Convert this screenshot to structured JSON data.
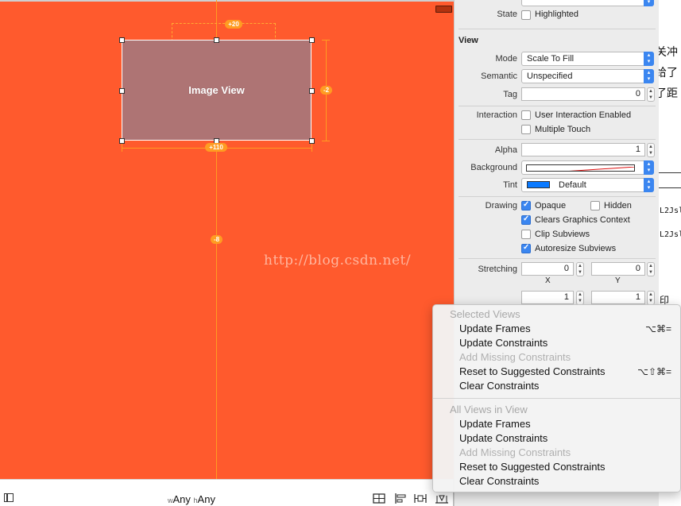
{
  "canvas": {
    "image_view_label": "Image View",
    "badges": {
      "top": "+20",
      "right": "-2",
      "bottom": "+110",
      "center": "-8"
    },
    "watermark": "http://blog.csdn.net/"
  },
  "bottom_bar": {
    "width_class_prefix": "w",
    "width_class_value": "Any",
    "height_class_prefix": "h",
    "height_class_value": "Any"
  },
  "inspector": {
    "state_label": "State",
    "highlighted_label": "Highlighted",
    "view_section": "View",
    "mode_label": "Mode",
    "mode_value": "Scale To Fill",
    "semantic_label": "Semantic",
    "semantic_value": "Unspecified",
    "tag_label": "Tag",
    "tag_value": "0",
    "interaction_label": "Interaction",
    "user_interaction": "User Interaction Enabled",
    "multiple_touch": "Multiple Touch",
    "alpha_label": "Alpha",
    "alpha_value": "1",
    "background_label": "Background",
    "tint_label": "Tint",
    "tint_value": "Default",
    "tint_color": "#0a7aff",
    "drawing_label": "Drawing",
    "opaque": "Opaque",
    "hidden": "Hidden",
    "clears_graphics": "Clears Graphics Context",
    "clip_subviews": "Clip Subviews",
    "autoresize_subviews": "Autoresize Subviews",
    "stretching_label": "Stretching",
    "stretch_x": "0",
    "stretch_y": "0",
    "x_caption": "X",
    "y_caption": "Y",
    "stretch_w": "1",
    "stretch_h": "1"
  },
  "right_strip": {
    "t1": "关冲",
    "t2": "给了",
    "t3": "了距",
    "t4": "L2Jsl",
    "t5": "L2Jsl",
    "t6": "印"
  },
  "menu": {
    "selected_header": "Selected Views",
    "selected_items": [
      {
        "label": "Update Frames",
        "shortcut": "⌥⌘=",
        "enabled": true
      },
      {
        "label": "Update Constraints",
        "shortcut": "",
        "enabled": true
      },
      {
        "label": "Add Missing Constraints",
        "shortcut": "",
        "enabled": false
      },
      {
        "label": "Reset to Suggested Constraints",
        "shortcut": "⌥⇧⌘=",
        "enabled": true
      },
      {
        "label": "Clear Constraints",
        "shortcut": "",
        "enabled": true
      }
    ],
    "all_header": "All Views in View",
    "all_items": [
      {
        "label": "Update Frames",
        "enabled": true
      },
      {
        "label": "Update Constraints",
        "enabled": true
      },
      {
        "label": "Add Missing Constraints",
        "enabled": false
      },
      {
        "label": "Reset to Suggested Constraints",
        "enabled": true
      },
      {
        "label": "Clear Constraints",
        "enabled": true
      }
    ]
  },
  "colors": {
    "canvas_bg": "#ff5a2d",
    "constraint": "#ff9c22",
    "image_view_bg": "#ae7474",
    "accent": "#3b86f0"
  }
}
